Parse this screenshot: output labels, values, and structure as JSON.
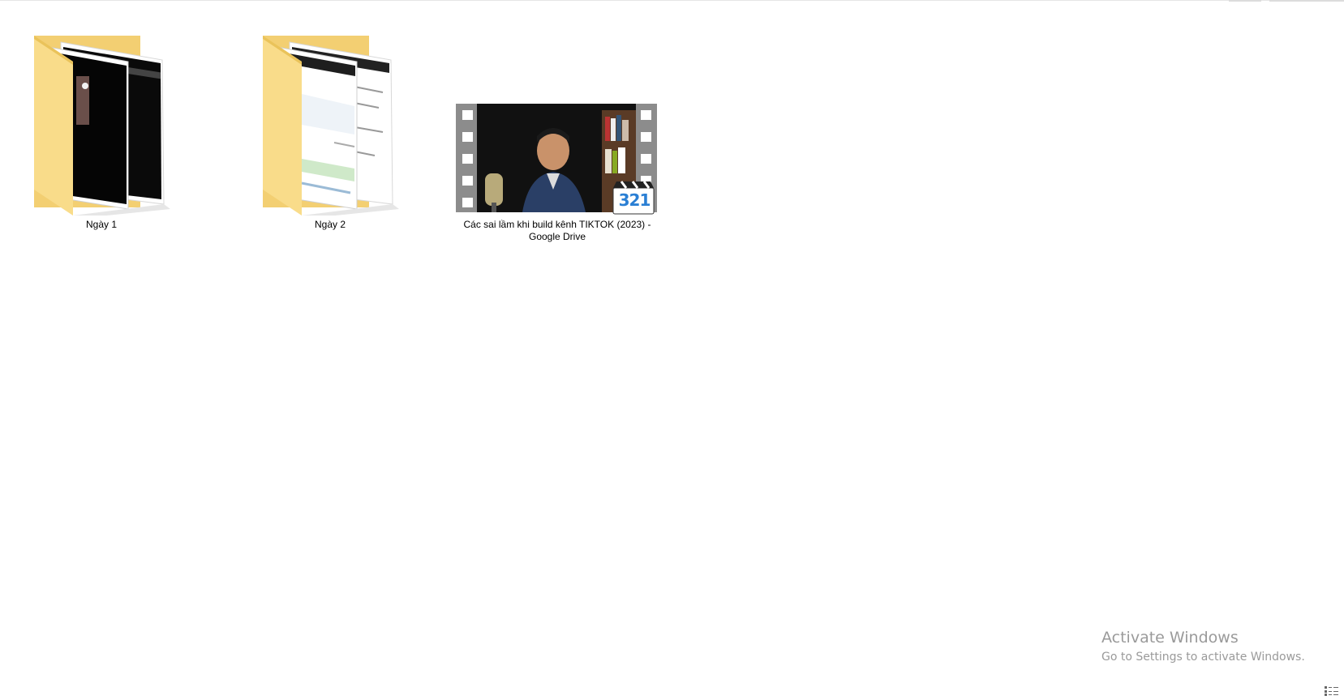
{
  "items": [
    {
      "name": "Ngày 1",
      "type": "folder"
    },
    {
      "name": "Ngày 2",
      "type": "folder"
    },
    {
      "name": "Các sai lầm khi build kênh TIKTOK (2023) - Google Drive",
      "type": "video"
    }
  ],
  "video_badge": "321",
  "watermark": {
    "title": "Activate Windows",
    "subtitle": "Go to Settings to activate Windows."
  },
  "colors": {
    "folder": "#f7d57a",
    "folder_dark": "#e9bd4b",
    "watermark": "#9a9a9a"
  },
  "icons": {
    "view_toggle": "details-view-icon"
  }
}
